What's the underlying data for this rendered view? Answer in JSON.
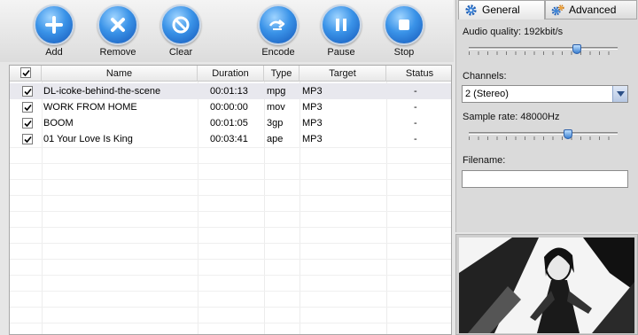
{
  "toolbar": {
    "add": "Add",
    "remove": "Remove",
    "clear": "Clear",
    "encode": "Encode",
    "pause": "Pause",
    "stop": "Stop"
  },
  "list": {
    "columns": [
      "Name",
      "Duration",
      "Type",
      "Target",
      "Status"
    ],
    "header_checked": true,
    "rows": [
      {
        "checked": true,
        "name": "DL-icoke-behind-the-scene",
        "duration": "00:01:13",
        "type": "mpg",
        "target": "MP3",
        "status": "-"
      },
      {
        "checked": true,
        "name": "WORK FROM HOME",
        "duration": "00:00:00",
        "type": "mov",
        "target": "MP3",
        "status": "-"
      },
      {
        "checked": true,
        "name": "BOOM",
        "duration": "00:01:05",
        "type": "3gp",
        "target": "MP3",
        "status": "-"
      },
      {
        "checked": true,
        "name": "01 Your Love Is King",
        "duration": "00:03:41",
        "type": "ape",
        "target": "MP3",
        "status": "-"
      }
    ]
  },
  "panel": {
    "tabs": [
      "General",
      "Advanced"
    ],
    "active_tab": "General",
    "audio_quality_label": "Audio quality: 192kbit/s",
    "audio_quality_level": 0.74,
    "channels_label": "Channels:",
    "channels_value": "2 (Stereo)",
    "sample_rate_label": "Sample rate: 48000Hz",
    "sample_rate_level": 0.68,
    "filename_label": "Filename:",
    "filename_value": ""
  },
  "colors": {
    "button_blue": "#1e6fd6",
    "selected_row": "#e8e8ee",
    "panel_bg": "#dadada"
  }
}
